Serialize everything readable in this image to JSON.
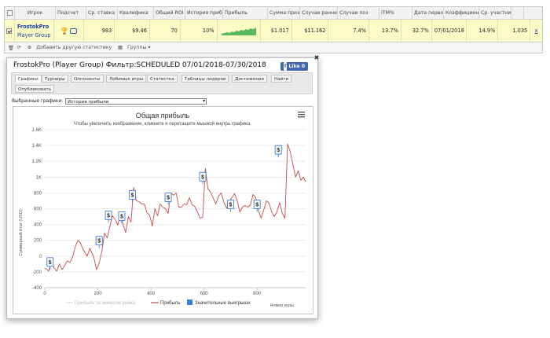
{
  "table": {
    "headers": [
      "",
      "Игрок",
      "Подсчет",
      "Ср. ставка",
      "Квалифика",
      "Общий ROI",
      "История прибы",
      "Прибыль",
      "Сумма призо",
      "Случаи раннего",
      "Случаи поз",
      "ITM%",
      "Дата первой",
      "Коэффициен",
      "Ср. участник",
      ""
    ],
    "row": {
      "player_name": "FrostokPro",
      "player_group": "Player Group",
      "count": "983",
      "avg_stake": "$9.46",
      "qualification": "70",
      "roi": "10%",
      "profit": "$1.017",
      "prize_sum": "$11.162",
      "early": "7.4%",
      "late": "13.7%",
      "itm": "32.7%",
      "first_date": "07/01/2018 1",
      "coef": "14.9%",
      "avg_entrants": "1.035",
      "remove": "x"
    },
    "tools": {
      "add_stats": "Добавить другую статистику",
      "groups": "Группы"
    }
  },
  "popup": {
    "title": "FrostokPro (Player Group) Фильтр:SCHEDULED 07/01/2018-07/30/2018",
    "like": "Like 0",
    "close": "✖",
    "tabs": [
      "Графики",
      "Турниры",
      "Оппоненты",
      "Лобимые игры",
      "Статистка",
      "Таблицы лидеров",
      "Достижения",
      "Найти",
      "Опубликовать"
    ],
    "selected_label": "Выбранные графики:",
    "selected_value": "История прибыли"
  },
  "chart_data": {
    "type": "line",
    "title": "Общая прибыль",
    "subtitle": "Чтобы увеличить изображение, кликните и перетащите мышкой внутрь графика.",
    "ylabel": "Суммарный итог (USD)",
    "xlabel": "Номер игры",
    "xlim": [
      0,
      983
    ],
    "ylim": [
      -400,
      1600
    ],
    "yticks": [
      "-400",
      "-200",
      "0",
      "200",
      "400",
      "600",
      "800",
      "1K",
      "1.2K",
      "1.4K",
      "1.6K"
    ],
    "ytick_values": [
      -400,
      -200,
      0,
      200,
      400,
      600,
      800,
      1000,
      1200,
      1400,
      1600
    ],
    "xticks": [
      "0",
      "200",
      "400",
      "600",
      "800"
    ],
    "xtick_values": [
      0,
      200,
      400,
      600,
      800
    ],
    "grid": true,
    "legend_position": "bottom",
    "legend": [
      "Прибыль за минусом рейка",
      "Прибыль",
      "Значительные выигрыши"
    ],
    "series": [
      {
        "name": "Прибыль",
        "color": "#c0504d",
        "x": [
          0,
          15,
          25,
          35,
          45,
          55,
          65,
          75,
          85,
          95,
          105,
          115,
          125,
          135,
          145,
          160,
          170,
          185,
          195,
          205,
          215,
          225,
          235,
          245,
          255,
          265,
          275,
          285,
          295,
          305,
          315,
          325,
          335,
          345,
          355,
          365,
          375,
          385,
          395,
          405,
          415,
          425,
          435,
          445,
          455,
          465,
          475,
          485,
          495,
          505,
          515,
          525,
          535,
          545,
          555,
          565,
          575,
          585,
          595,
          605,
          615,
          625,
          635,
          645,
          655,
          665,
          675,
          685,
          695,
          705,
          715,
          725,
          735,
          745,
          755,
          765,
          775,
          785,
          795,
          805,
          815,
          825,
          835,
          845,
          855,
          865,
          875,
          885,
          895,
          905,
          915,
          925,
          935,
          945,
          955,
          965,
          975,
          983
        ],
        "y": [
          -150,
          -190,
          -60,
          -150,
          -190,
          -100,
          -170,
          -120,
          -60,
          -80,
          -10,
          120,
          200,
          160,
          80,
          0,
          100,
          -20,
          -170,
          -90,
          60,
          290,
          230,
          370,
          510,
          470,
          390,
          540,
          400,
          300,
          500,
          430,
          870,
          700,
          690,
          660,
          660,
          550,
          520,
          380,
          600,
          510,
          660,
          620,
          600,
          540,
          800,
          770,
          800,
          620,
          620,
          660,
          650,
          740,
          650,
          630,
          560,
          480,
          490,
          1110,
          850,
          810,
          730,
          660,
          760,
          800,
          680,
          610,
          690,
          740,
          790,
          700,
          560,
          620,
          640,
          620,
          650,
          780,
          740,
          580,
          480,
          580,
          700,
          670,
          560,
          500,
          560,
          680,
          540,
          480,
          1420,
          1320,
          1160,
          1000,
          1080,
          960,
          1000,
          940
        ]
      }
    ],
    "big_wins": [
      {
        "x": 20,
        "y": -80
      },
      {
        "x": 205,
        "y": 190
      },
      {
        "x": 240,
        "y": 510
      },
      {
        "x": 290,
        "y": 500
      },
      {
        "x": 330,
        "y": 770
      },
      {
        "x": 465,
        "y": 740
      },
      {
        "x": 595,
        "y": 1000
      },
      {
        "x": 700,
        "y": 650
      },
      {
        "x": 800,
        "y": 650
      },
      {
        "x": 880,
        "y": 1340
      }
    ]
  }
}
